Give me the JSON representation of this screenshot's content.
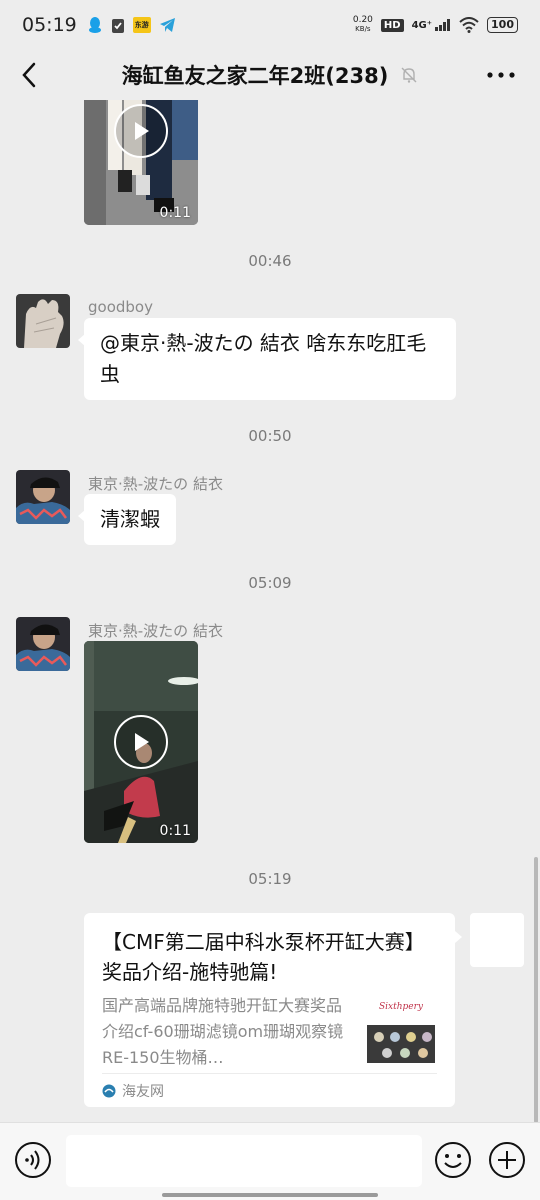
{
  "status_bar": {
    "time": "05:19",
    "speed": "0.20",
    "speed_unit": "KB/s",
    "hd": "HD",
    "network": "4G⁺",
    "battery": "100",
    "app_badge": "东游"
  },
  "header": {
    "title": "海缸鱼友之家二年2班(238)"
  },
  "messages": {
    "video_1_duration": "0:11",
    "ts_1": "00:46",
    "msg_2_sender": "goodboy",
    "msg_2_text": "@東京·熱-波たの 結衣 啥东东吃肛毛虫",
    "ts_2": "00:50",
    "msg_3_sender": "東京·熱-波たの 結衣",
    "msg_3_text": "清潔蝦",
    "ts_3": "05:09",
    "msg_4_sender": "東京·熱-波たの 結衣",
    "video_2_duration": "0:11",
    "ts_4": "05:19"
  },
  "link_card": {
    "title": "【CMF第二届中科水泵杯开缸大赛】奖品介绍-施特驰篇!",
    "description": "国产高端品牌施特驰开缸大赛奖品介绍cf-60珊瑚滤镜om珊瑚观察镜RE-150生物桶…",
    "source": "海友网",
    "thumb_brand": "Sixthpery"
  },
  "colors": {
    "background": "#ededed",
    "bubble": "#ffffff",
    "timestamp": "#7a7a7a",
    "sender": "#8a8a8a"
  }
}
